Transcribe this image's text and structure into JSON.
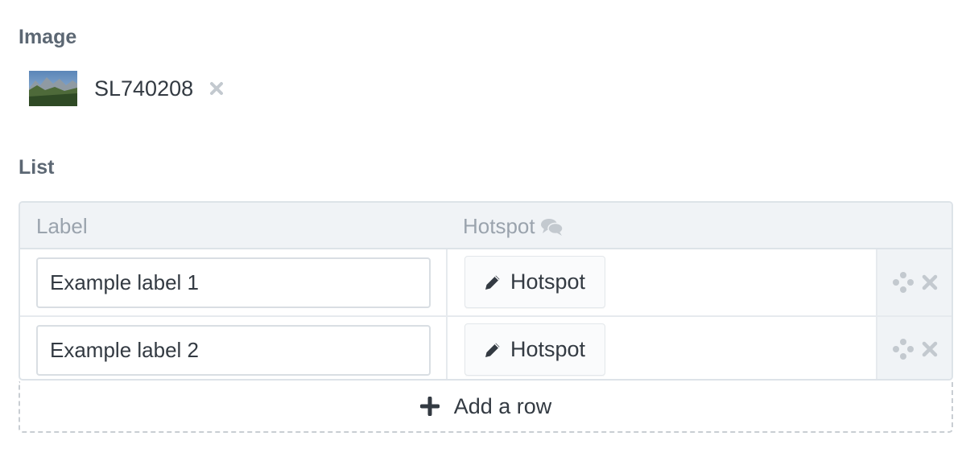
{
  "image_field": {
    "title": "Image",
    "filename": "SL740208",
    "remove_icon": "close-icon"
  },
  "list_field": {
    "title": "List",
    "columns": {
      "label": "Label",
      "hotspot": "Hotspot"
    },
    "rows": [
      {
        "label_value": "Example label 1",
        "hotspot_button": "Hotspot"
      },
      {
        "label_value": "Example label 2",
        "hotspot_button": "Hotspot"
      }
    ],
    "add_row_label": "Add a row"
  },
  "colors": {
    "title": "#5c6773",
    "text": "#333a42",
    "muted": "#9aa3ad",
    "icon_muted": "#c3c9cf",
    "header_bg": "#f0f3f6",
    "border": "#dde3e8"
  }
}
